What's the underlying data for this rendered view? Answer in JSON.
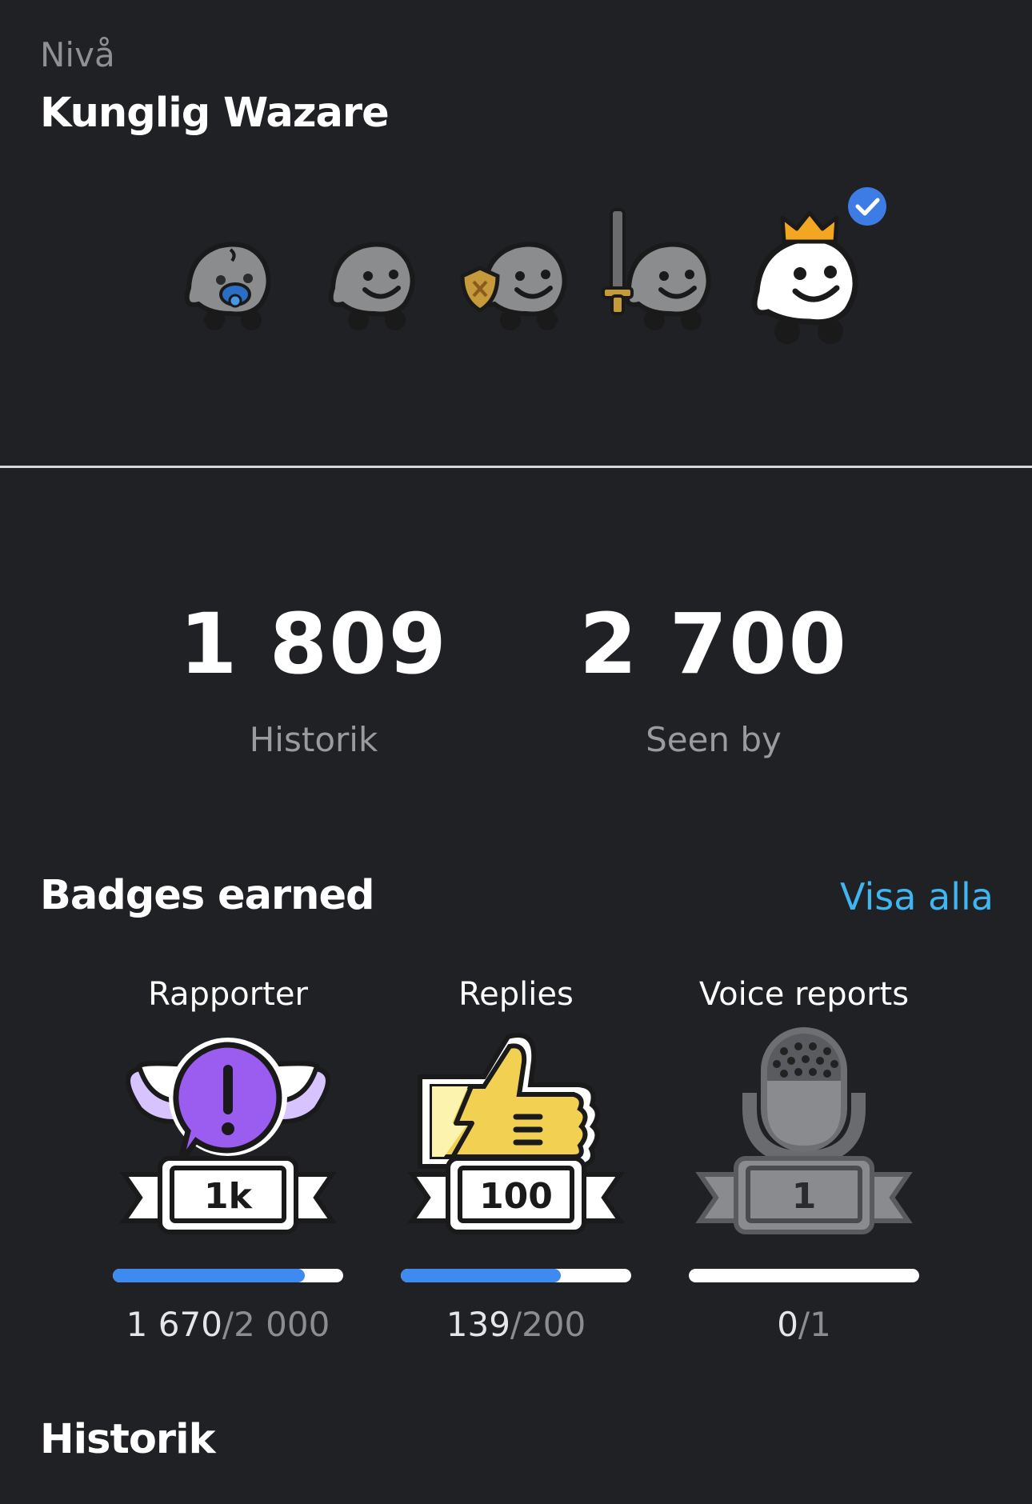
{
  "level": {
    "label": "Nivå",
    "name": "Kunglig Wazare",
    "avatars": [
      {
        "icon": "baby-wazer-icon",
        "achieved": false
      },
      {
        "icon": "wazer-icon",
        "achieved": false
      },
      {
        "icon": "shield-wazer-icon",
        "achieved": false
      },
      {
        "icon": "sword-wazer-icon",
        "achieved": false
      },
      {
        "icon": "crown-wazer-icon",
        "achieved": true,
        "current": true
      }
    ]
  },
  "stats": [
    {
      "value": "1 809",
      "label": "Historik"
    },
    {
      "value": "2 700",
      "label": "Seen by"
    }
  ],
  "badges_section": {
    "title": "Badges earned",
    "see_all": "Visa alla",
    "badges": [
      {
        "name": "Rapporter",
        "tier": "1k",
        "current": "1 670",
        "total": "/2 000",
        "progress": 0.835,
        "icon": "report-badge-icon"
      },
      {
        "name": "Replies",
        "tier": "100",
        "current": "139",
        "total": "/200",
        "progress": 0.695,
        "icon": "thumbs-up-badge-icon"
      },
      {
        "name": "Voice reports",
        "tier": "1",
        "current": "0",
        "total": "/1",
        "progress": 0,
        "icon": "microphone-badge-icon"
      }
    ]
  },
  "history": {
    "title": "Historik"
  },
  "colors": {
    "background": "#202124",
    "accent_link": "#3fb6f1",
    "progress_fill": "#3d8af0",
    "check_badge": "#3d7be5",
    "report_purple": "#9b5cf0",
    "thumb_yellow": "#f2d052"
  }
}
